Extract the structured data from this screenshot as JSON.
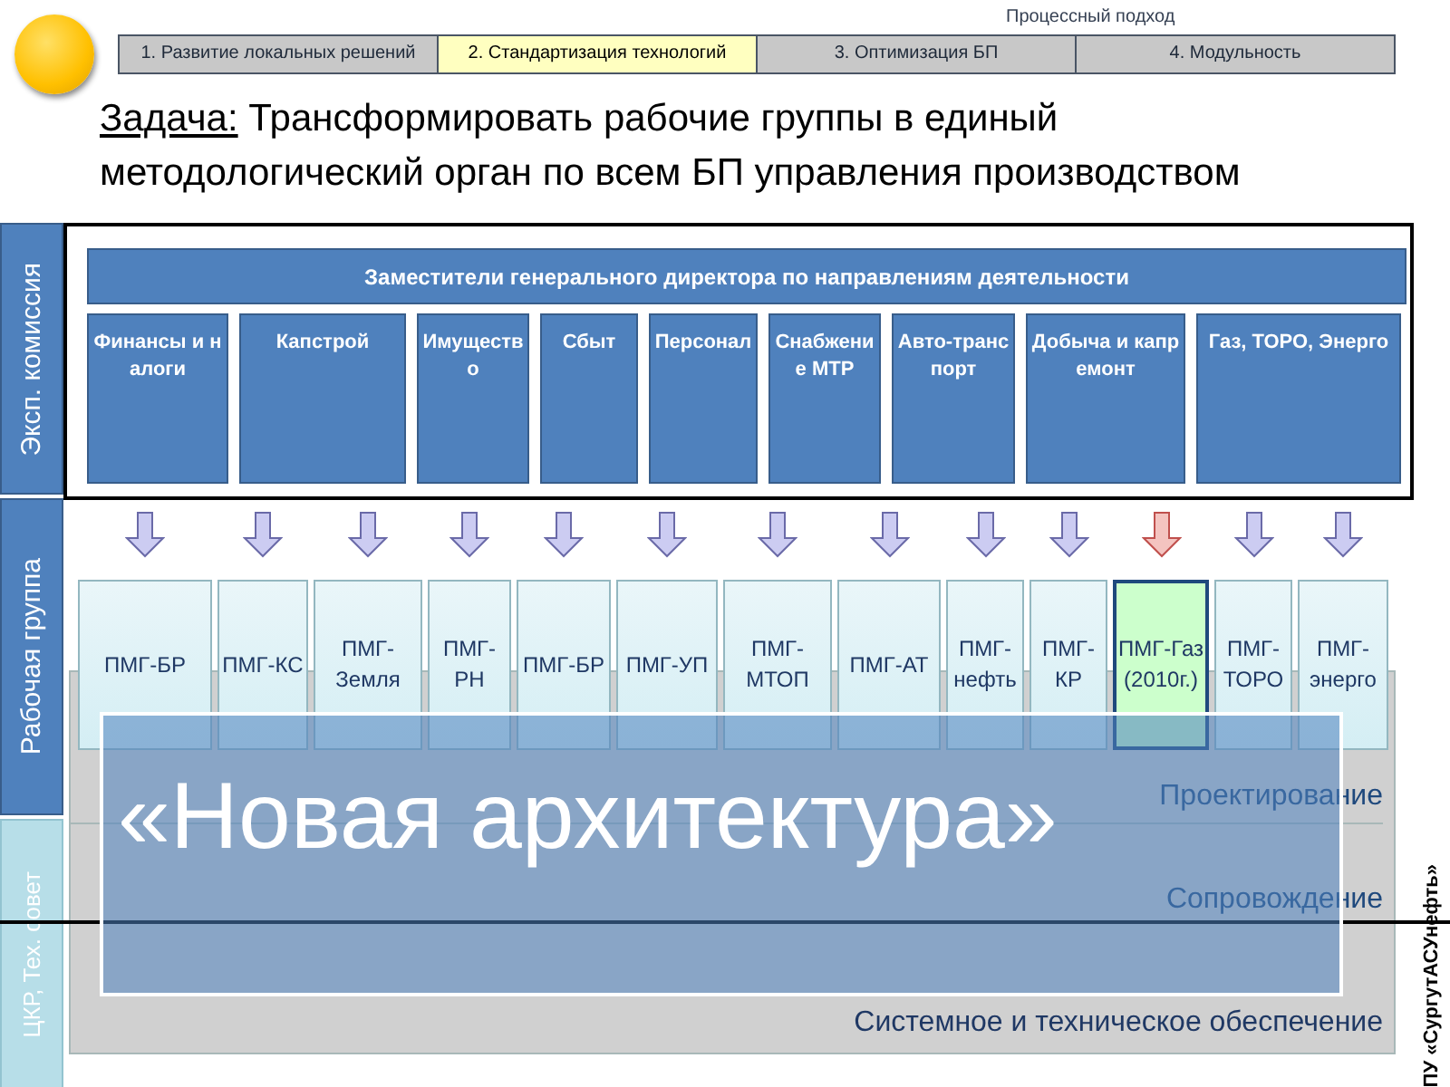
{
  "header": {
    "label": "Процессный подход",
    "steps": [
      {
        "label": "1. Развитие локальных решений",
        "selected": false
      },
      {
        "label": "2. Стандартизация технологий",
        "selected": true
      },
      {
        "label": "3. Оптимизация БП",
        "selected": false
      },
      {
        "label": "4. Модульность",
        "selected": false
      }
    ]
  },
  "task": {
    "label": "Задача:",
    "text": "Трансформировать рабочие группы в единый методологический орган по всем БП управления производством"
  },
  "side_labels": [
    "Эксп. комиссия",
    "Рабочая группа",
    "ЦКР, Тех. совет"
  ],
  "directors": {
    "title": "Заместители генерального директора по направлениям деятельности",
    "departments": [
      "Финансы и налоги",
      "Капстрой",
      "Имущество",
      "Сбыт",
      "Персонал",
      "Снабжение МТР",
      "Авто-транспорт",
      "Добыча и капремонт",
      "Газ, ТОРО, Энерго"
    ]
  },
  "working_groups": [
    {
      "label": "ПМГ-БР",
      "highlighted": false
    },
    {
      "label": "ПМГ-КС",
      "highlighted": false
    },
    {
      "label": "ПМГ-Земля",
      "highlighted": false
    },
    {
      "label": "ПМГ-РН",
      "highlighted": false
    },
    {
      "label": "ПМГ-БР",
      "highlighted": false
    },
    {
      "label": "ПМГ-УП",
      "highlighted": false
    },
    {
      "label": "ПМГ-МТОП",
      "highlighted": false
    },
    {
      "label": "ПМГ-АТ",
      "highlighted": false
    },
    {
      "label": "ПМГ-нефть",
      "highlighted": false
    },
    {
      "label": "ПМГ-КР",
      "highlighted": false
    },
    {
      "label": "ПМГ-Газ (2010г.)",
      "highlighted": true
    },
    {
      "label": "ПМГ-ТОРО",
      "highlighted": false
    },
    {
      "label": "ПМГ-энерго",
      "highlighted": false
    }
  ],
  "layers": [
    "Проектирование",
    "Сопровождение",
    "Системное и техническое обеспечение"
  ],
  "overlay": {
    "text": "«Новая архитектура»"
  },
  "vendor": "ПУ «СургутАСУнефть»"
}
